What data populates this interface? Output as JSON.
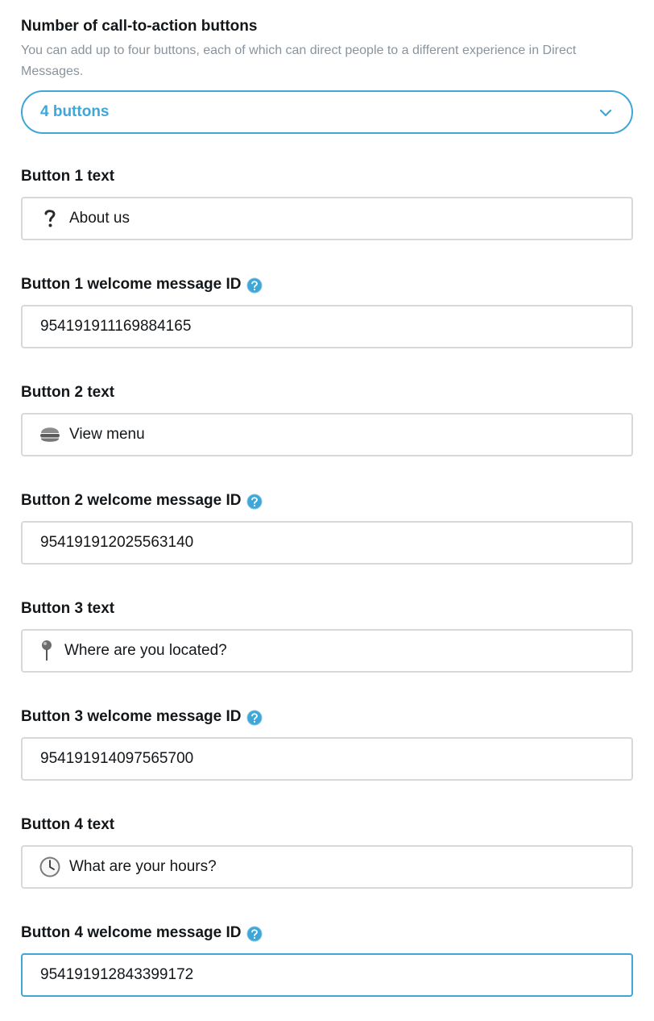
{
  "cta": {
    "title": "Number of call-to-action buttons",
    "description": "You can add up to four buttons, each of which can direct people to a different experience in Direct Messages.",
    "selected": "4 buttons"
  },
  "buttons": [
    {
      "text_label": "Button 1 text",
      "text_value": "About us",
      "emoji": "question-mark",
      "id_label": "Button 1 welcome message ID",
      "id_value": "954191911169884165"
    },
    {
      "text_label": "Button 2 text",
      "text_value": "View menu",
      "emoji": "burger",
      "id_label": "Button 2 welcome message ID",
      "id_value": "954191912025563140"
    },
    {
      "text_label": "Button 3 text",
      "text_value": "Where are you located?",
      "emoji": "pushpin",
      "id_label": "Button 3 welcome message ID",
      "id_value": "954191914097565700"
    },
    {
      "text_label": "Button 4 text",
      "text_value": "What are your hours?",
      "emoji": "clock",
      "id_label": "Button 4 welcome message ID",
      "id_value": "954191912843399172"
    }
  ],
  "colors": {
    "accent": "#3fa6d8",
    "border": "#d6d9dc",
    "muted_text": "#8a939b"
  }
}
